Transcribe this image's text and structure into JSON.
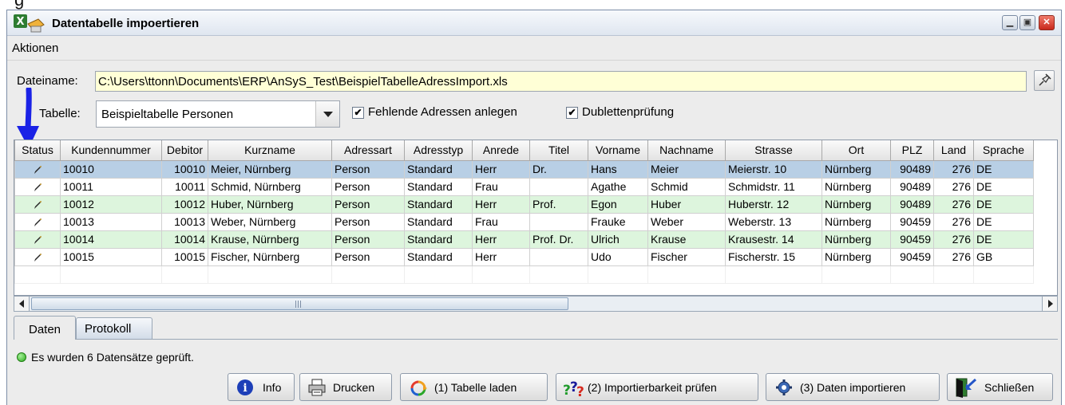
{
  "top_fragment": "g",
  "window": {
    "title": "Datentabelle impoertieren",
    "icon": "excel-import-icon",
    "controls": [
      "minimize-icon",
      "maximize-icon",
      "close-icon"
    ]
  },
  "menu": {
    "aktionen": "Aktionen"
  },
  "form": {
    "datei_label": "Dateiname:",
    "datei_value": "C:\\Users\\ttonn\\Documents\\ERP\\AnSyS_Test\\BeispielTabelleAdressImport.xls",
    "tabelle_label": "Tabelle:",
    "tabelle_value": "Beispieltabelle Personen",
    "check_fehlende": "Fehlende Adressen anlegen",
    "check_dubletten": "Dublettenprüfung",
    "check_fehlende_checked": true,
    "check_dubletten_checked": true
  },
  "table": {
    "columns": [
      "Status",
      "Kundennummer",
      "Debitor",
      "Kurzname",
      "Adressart",
      "Adresstyp",
      "Anrede",
      "Titel",
      "Vorname",
      "Nachname",
      "Strasse",
      "Ort",
      "PLZ",
      "Land",
      "Sprache"
    ],
    "rows": [
      {
        "status": "pencil-icon",
        "cells": [
          "10010",
          "10010",
          "Meier, Nürnberg",
          "Person",
          "Standard",
          "Herr",
          "Dr.",
          "Hans",
          "Meier",
          "Meierstr. 10",
          "Nürnberg",
          "90489",
          "276",
          "DE"
        ]
      },
      {
        "status": "pencil-icon",
        "cells": [
          "10011",
          "10011",
          "Schmid, Nürnberg",
          "Person",
          "Standard",
          "Frau",
          "",
          "Agathe",
          "Schmid",
          "Schmidstr. 11",
          "Nürnberg",
          "90489",
          "276",
          "DE"
        ]
      },
      {
        "status": "pencil-icon",
        "cells": [
          "10012",
          "10012",
          "Huber, Nürnberg",
          "Person",
          "Standard",
          "Herr",
          "Prof.",
          "Egon",
          "Huber",
          "Huberstr. 12",
          "Nürnberg",
          "90489",
          "276",
          "DE"
        ]
      },
      {
        "status": "pencil-icon",
        "cells": [
          "10013",
          "10013",
          "Weber, Nürnberg",
          "Person",
          "Standard",
          "Frau",
          "",
          "Frauke",
          "Weber",
          "Weberstr. 13",
          "Nürnberg",
          "90459",
          "276",
          "DE"
        ]
      },
      {
        "status": "pencil-icon",
        "cells": [
          "10014",
          "10014",
          "Krause, Nürnberg",
          "Person",
          "Standard",
          "Herr",
          "Prof. Dr.",
          "Ulrich",
          "Krause",
          "Krausestr. 14",
          "Nürnberg",
          "90459",
          "276",
          "DE"
        ]
      },
      {
        "status": "pencil-icon",
        "cells": [
          "10015",
          "10015",
          "Fischer, Nürnberg",
          "Person",
          "Standard",
          "Herr",
          "",
          "Udo",
          "Fischer",
          "Fischerstr. 15",
          "Nürnberg",
          "90459",
          "276",
          "GB"
        ]
      }
    ]
  },
  "tabs": {
    "daten": "Daten",
    "protokoll": "Protokoll"
  },
  "status": {
    "text": "Es wurden 6 Datensätze geprüft."
  },
  "buttons": {
    "info": "Info",
    "drucken": "Drucken",
    "laden": "(1) Tabelle laden",
    "pruefen": "(2) Importierbarkeit prüfen",
    "importieren": "(3) Daten importieren",
    "schliessen": "Schließen"
  },
  "colors": {
    "selected_row": "#b8cfe5",
    "alt_row": "#ddf5dd",
    "file_field": "#ffffd6",
    "arrow": "#1a22e6"
  }
}
